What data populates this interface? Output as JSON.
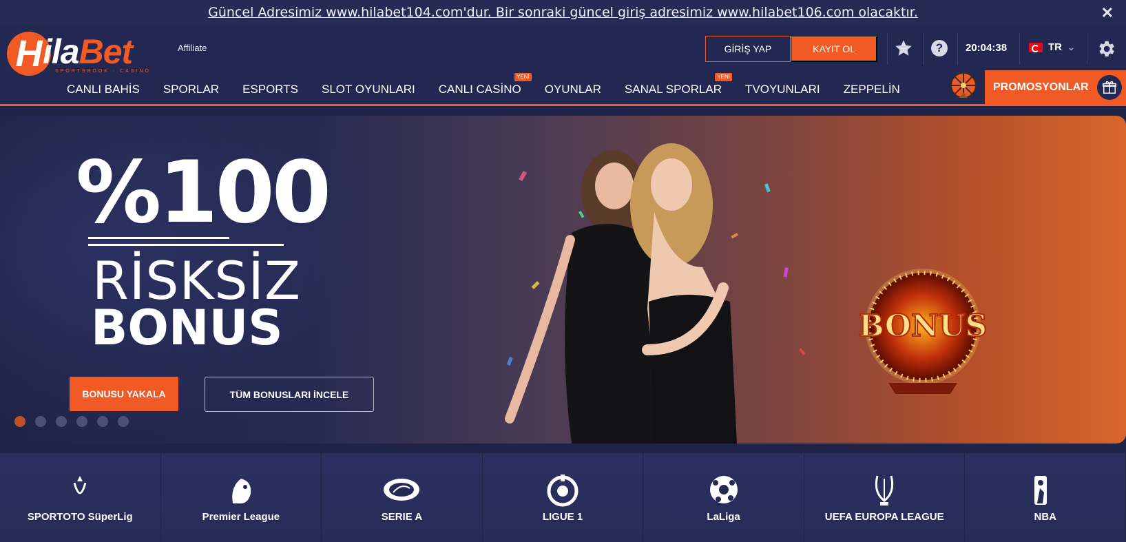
{
  "announcement": {
    "text": "Güncel Adresimiz www.hilabet104.com'dur. Bir sonraki güncel giriş adresimiz www.hilabet106.com olacaktır.",
    "close": "✕"
  },
  "header": {
    "logo": {
      "word_prefix": "ila",
      "word_suffix": "Bet",
      "sub": "SPORTSBOOK · CASINO",
      "initial": "H"
    },
    "affiliate": "Affiliate",
    "login_label": "GİRİŞ YAP",
    "register_label": "KAYIT OL",
    "clock": "20:04:38",
    "language": "TR",
    "promo_label": "PROMOSYONLAR",
    "colors": {
      "accent": "#f15a24",
      "header_bg": "#232852"
    }
  },
  "nav": {
    "items": [
      {
        "label": "CANLI BAHİS",
        "badge": ""
      },
      {
        "label": "SPORLAR",
        "badge": ""
      },
      {
        "label": "ESPORTS",
        "badge": ""
      },
      {
        "label": "SLOT OYUNLARI",
        "badge": ""
      },
      {
        "label": "CANLI CASİNO",
        "badge": "YENİ"
      },
      {
        "label": "OYUNLAR",
        "badge": ""
      },
      {
        "label": "SANAL SPORLAR",
        "badge": "YENİ"
      },
      {
        "label": "TVOYUNLARI",
        "badge": ""
      },
      {
        "label": "ZEPPELİN",
        "badge": ""
      }
    ]
  },
  "hero": {
    "headline": "%100",
    "line2": "RİSKSİZ",
    "line3": "BONUS",
    "cta_primary": "BONUSU YAKALA",
    "cta_secondary": "TÜM BONUSLARI İNCELE",
    "sign_text": "BONUS",
    "slides_total": 6,
    "active_slide": 1
  },
  "leagues": [
    {
      "name": "SPORTOTO SüperLig",
      "icon": "superlig-logo-icon"
    },
    {
      "name": "Premier League",
      "icon": "premier-league-logo-icon"
    },
    {
      "name": "SERIE A",
      "icon": "serie-a-logo-icon"
    },
    {
      "name": "LIGUE 1",
      "icon": "ligue1-logo-icon"
    },
    {
      "name": "LaLiga",
      "icon": "laliga-logo-icon"
    },
    {
      "name": "UEFA EUROPA LEAGUE",
      "icon": "europa-league-logo-icon"
    },
    {
      "name": "NBA",
      "icon": "nba-logo-icon"
    }
  ]
}
